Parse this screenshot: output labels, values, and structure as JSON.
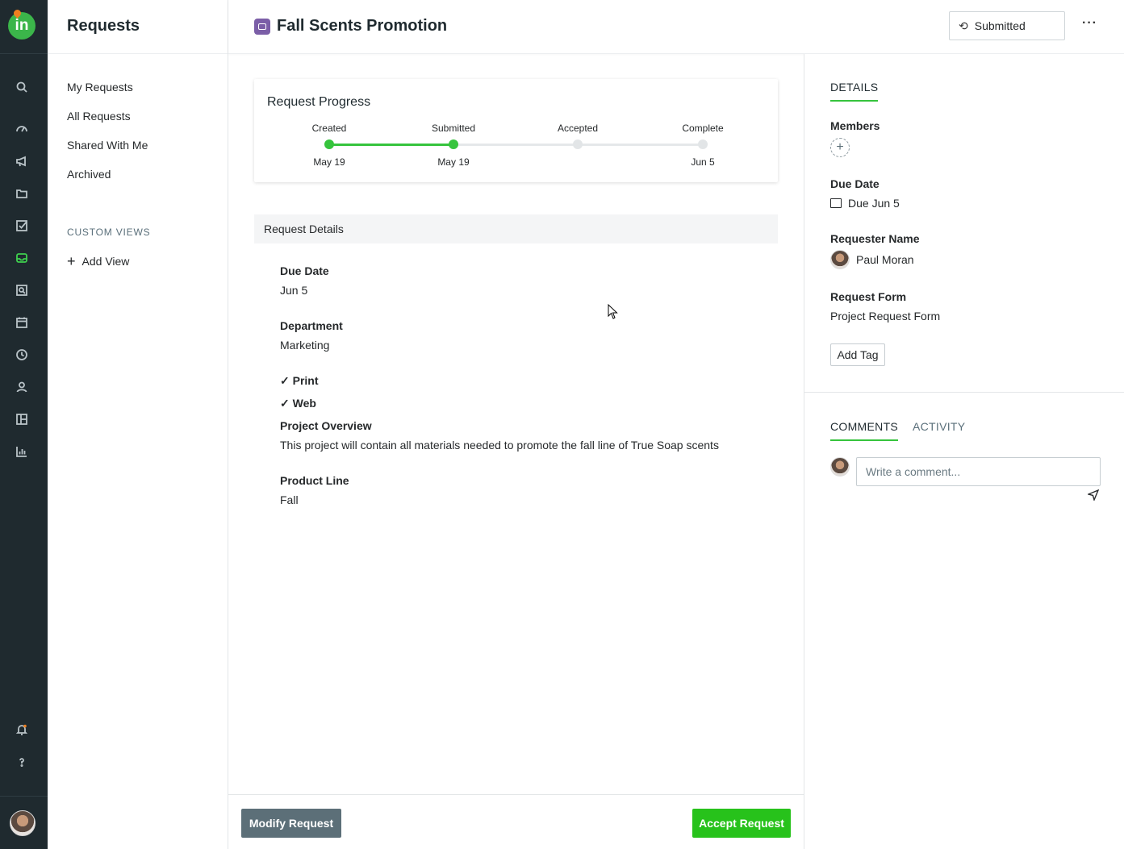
{
  "app": {
    "logo_text": "in",
    "rail_icons": [
      "search-icon",
      "dashboard-icon",
      "megaphone-icon",
      "folder-icon",
      "checkbox-icon",
      "inbox-icon",
      "search-report-icon",
      "calendar-icon",
      "clock-icon",
      "user-icon",
      "layout-icon",
      "bar-chart-icon"
    ],
    "rail_bottom_icons": [
      "bell-icon",
      "help-icon"
    ],
    "accent_color": "#36c43d"
  },
  "subnav": {
    "title": "Requests",
    "items": [
      {
        "label": "My Requests"
      },
      {
        "label": "All Requests"
      },
      {
        "label": "Shared With Me"
      },
      {
        "label": "Archived"
      }
    ],
    "custom_views_label": "CUSTOM VIEWS",
    "add_view_label": "Add View"
  },
  "header": {
    "title": "Fall Scents Promotion",
    "status_label": "Submitted",
    "more_label": "···"
  },
  "progress": {
    "title": "Request Progress",
    "completed_fraction": 0.333,
    "steps": [
      {
        "label": "Created",
        "date": "May 19",
        "done": true
      },
      {
        "label": "Submitted",
        "date": "May 19",
        "done": true
      },
      {
        "label": "Accepted",
        "date": "",
        "done": false
      },
      {
        "label": "Complete",
        "date": "Jun 5",
        "done": false
      }
    ]
  },
  "request_details": {
    "section_title": "Request Details",
    "due_date_label": "Due Date",
    "due_date_value": "Jun 5",
    "department_label": "Department",
    "department_value": "Marketing",
    "checks": [
      "✓ Print",
      "✓ Web"
    ],
    "overview_label": "Project Overview",
    "overview_value": "This project will contain all materials needed to promote the fall line of True Soap scents",
    "product_line_label": "Product Line",
    "product_line_value": "Fall"
  },
  "footer": {
    "modify_label": "Modify Request",
    "accept_label": "Accept Request"
  },
  "right_panel": {
    "details_tab": "DETAILS",
    "members_label": "Members",
    "due_date_label": "Due Date",
    "due_date_value": "Due Jun 5",
    "requester_label": "Requester Name",
    "requester_value": "Paul Moran",
    "form_label": "Request Form",
    "form_value": "Project Request Form",
    "add_tag_label": "Add Tag",
    "comments_tab": "COMMENTS",
    "activity_tab": "ACTIVITY",
    "comment_placeholder": "Write a comment..."
  }
}
